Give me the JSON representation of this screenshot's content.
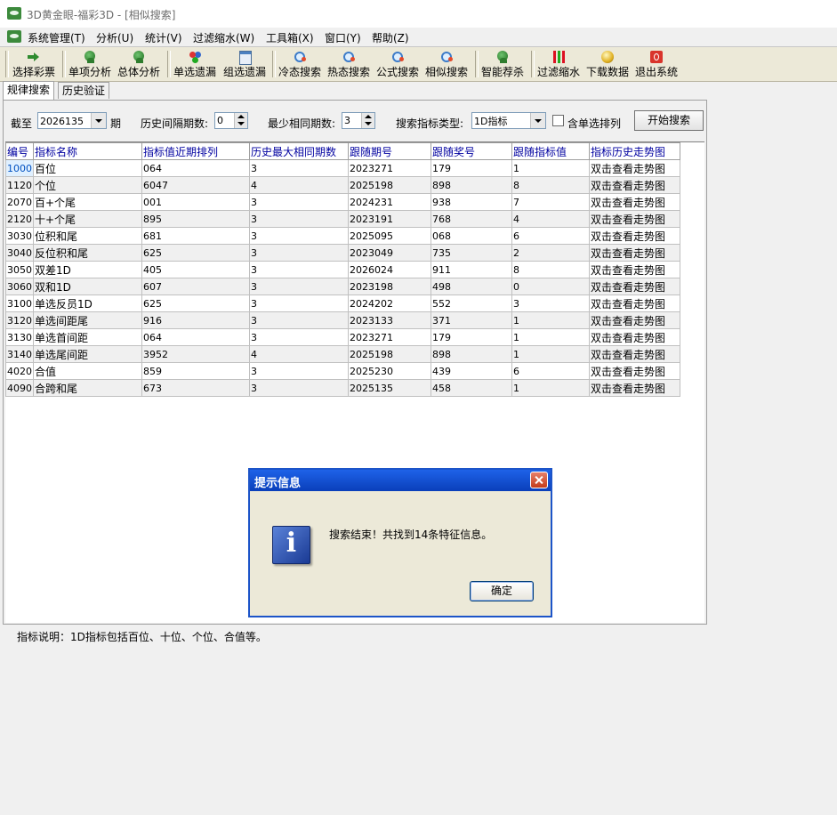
{
  "window": {
    "title": "3D黄金眼-福彩3D - [相似搜索]"
  },
  "menu": [
    "系统管理(T)",
    "分析(U)",
    "统计(V)",
    "过滤缩水(W)",
    "工具箱(X)",
    "窗口(Y)",
    "帮助(Z)"
  ],
  "toolbar": {
    "select_lottery": "选择彩票",
    "single_analysis": "单项分析",
    "overall_analysis": "总体分析",
    "single_missing": "单选遗漏",
    "group_missing": "组选遗漏",
    "cold_search": "冷态搜索",
    "hot_search": "热态搜索",
    "formula_search": "公式搜索",
    "similar_search": "相似搜索",
    "smart_recommend": "智能荐杀",
    "filter_shrink": "过滤缩水",
    "download_data": "下载数据",
    "exit_system": "退出系统"
  },
  "tabs": [
    "规律搜索",
    "历史验证"
  ],
  "form": {
    "cutoff_label": "截至",
    "cutoff_value": "2026135",
    "period_suffix": "期",
    "interval_label": "历史间隔期数:",
    "interval_value": "0",
    "min_same_label": "最少相同期数:",
    "min_same_value": "3",
    "type_label": "搜索指标类型:",
    "type_value": "1D指标",
    "include_single_label": "含单选排列",
    "start_button": "开始搜索"
  },
  "grid": {
    "columns": [
      "编号",
      "指标名称",
      "指标值近期排列",
      "历史最大相同期数",
      "跟随期号",
      "跟随奖号",
      "跟随指标值",
      "指标历史走势图"
    ],
    "rows": [
      [
        "1000",
        "百位",
        "064",
        "3",
        "2023271",
        "179",
        "1",
        "双击查看走势图"
      ],
      [
        "1120",
        "个位",
        "6047",
        "4",
        "2025198",
        "898",
        "8",
        "双击查看走势图"
      ],
      [
        "2070",
        "百+个尾",
        "001",
        "3",
        "2024231",
        "938",
        "7",
        "双击查看走势图"
      ],
      [
        "2120",
        "十+个尾",
        "895",
        "3",
        "2023191",
        "768",
        "4",
        "双击查看走势图"
      ],
      [
        "3030",
        "位积和尾",
        "681",
        "3",
        "2025095",
        "068",
        "6",
        "双击查看走势图"
      ],
      [
        "3040",
        "反位积和尾",
        "625",
        "3",
        "2023049",
        "735",
        "2",
        "双击查看走势图"
      ],
      [
        "3050",
        "双差1D",
        "405",
        "3",
        "2026024",
        "911",
        "8",
        "双击查看走势图"
      ],
      [
        "3060",
        "双和1D",
        "607",
        "3",
        "2023198",
        "498",
        "0",
        "双击查看走势图"
      ],
      [
        "3100",
        "单选反员1D",
        "625",
        "3",
        "2024202",
        "552",
        "3",
        "双击查看走势图"
      ],
      [
        "3120",
        "单选间距尾",
        "916",
        "3",
        "2023133",
        "371",
        "1",
        "双击查看走势图"
      ],
      [
        "3130",
        "单选首间距",
        "064",
        "3",
        "2023271",
        "179",
        "1",
        "双击查看走势图"
      ],
      [
        "3140",
        "单选尾间距",
        "3952",
        "4",
        "2025198",
        "898",
        "1",
        "双击查看走势图"
      ],
      [
        "4020",
        "合值",
        "859",
        "3",
        "2025230",
        "439",
        "6",
        "双击查看走势图"
      ],
      [
        "4090",
        "合跨和尾",
        "673",
        "3",
        "2025135",
        "458",
        "1",
        "双击查看走势图"
      ]
    ]
  },
  "status": "指标说明：1D指标包括百位、十位、个位、合值等。",
  "dialog": {
    "title": "提示信息",
    "message": "搜索结束！共找到14条特征信息。",
    "ok": "确定",
    "icon_glyph": "i"
  },
  "colors": {
    "dialog_title": "#0a3fba",
    "header_text": "#0000a0"
  }
}
